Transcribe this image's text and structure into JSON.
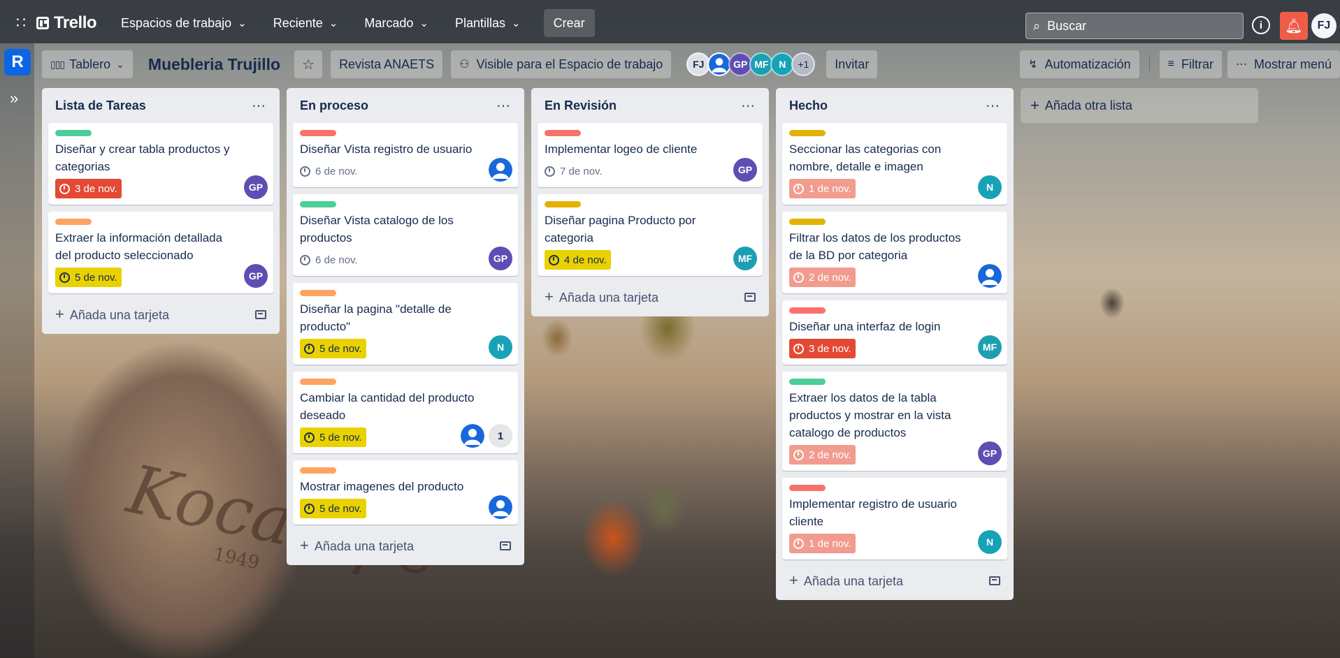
{
  "topbar": {
    "brand": "Trello",
    "nav": [
      {
        "label": "Espacios de trabajo"
      },
      {
        "label": "Reciente"
      },
      {
        "label": "Marcado"
      },
      {
        "label": "Plantillas"
      }
    ],
    "create_label": "Crear",
    "search_placeholder": "Buscar",
    "user_initials": "FJ"
  },
  "workspace_badge": "R",
  "board": {
    "view_label": "Tablero",
    "title": "Muebleria Trujillo",
    "workspace_label": "Revista ANAETS",
    "visibility_label": "Visible para el Espacio de trabajo",
    "members": [
      {
        "initials": "FJ"
      },
      {
        "initials": ""
      },
      {
        "initials": "GP"
      },
      {
        "initials": "MF"
      },
      {
        "initials": "N"
      }
    ],
    "extra_members": "+1",
    "invite_label": "Invitar",
    "automation_label": "Automatización",
    "filter_label": "Filtrar",
    "menu_label": "Mostrar menú",
    "add_list_label": "Añada otra lista",
    "add_card_label": "Añada una tarjeta"
  },
  "lists": [
    {
      "title": "Lista de Tareas",
      "cards": [
        {
          "label_color": "#4bce97",
          "title": "Diseñar y crear tabla productos y categorias",
          "due": "3 de nov.",
          "member": "GP"
        },
        {
          "label_color": "#fea362",
          "title": "Extraer la información detallada del producto seleccionado",
          "due": "5 de nov.",
          "member": "GP"
        }
      ]
    },
    {
      "title": "En proceso",
      "cards": [
        {
          "label_color": "#f87168",
          "title": "Diseñar Vista registro de usuario",
          "due": "6 de nov."
        },
        {
          "label_color": "#4bce97",
          "title": "Diseñar Vista catalogo de los productos",
          "due": "6 de nov.",
          "member": "GP"
        },
        {
          "label_color": "#fea362",
          "title": "Diseñar la pagina \"detalle de producto\"",
          "due": "5 de nov.",
          "member": "N"
        },
        {
          "label_color": "#fea362",
          "title": "Cambiar la cantidad del producto deseado",
          "due": "5 de nov.",
          "comments": "1"
        },
        {
          "label_color": "#fea362",
          "title": "Mostrar imagenes del producto",
          "due": "5 de nov."
        }
      ]
    },
    {
      "title": "En Revisión",
      "cards": [
        {
          "label_color": "#f87168",
          "title": "Implementar logeo de cliente",
          "due": "7 de nov.",
          "member": "GP"
        },
        {
          "label_color": "#e2b203",
          "title": "Diseñar pagina Producto por categoria",
          "due": "4 de nov.",
          "member": "MF"
        }
      ]
    },
    {
      "title": "Hecho",
      "cards": [
        {
          "label_color": "#e2b203",
          "title": "Seccionar las categorias con nombre, detalle e imagen",
          "due": "1 de nov.",
          "member": "N"
        },
        {
          "label_color": "#e2b203",
          "title": "Filtrar los datos de los productos de la BD por categoria",
          "due": "2 de nov."
        },
        {
          "label_color": "#f87168",
          "title": "Diseñar una interfaz de login",
          "due": "3 de nov.",
          "member": "MF"
        },
        {
          "label_color": "#4bce97",
          "title": "Extraer los datos de la tabla productos y mostrar en la vista catalogo de productos",
          "due": "2 de nov.",
          "member": "GP"
        },
        {
          "label_color": "#f87168",
          "title": "Implementar registro de usuario cliente",
          "due": "1 de nov.",
          "member": "N"
        }
      ]
    }
  ],
  "background_watermark": "Kocatepe",
  "background_watermark_year": "1949"
}
